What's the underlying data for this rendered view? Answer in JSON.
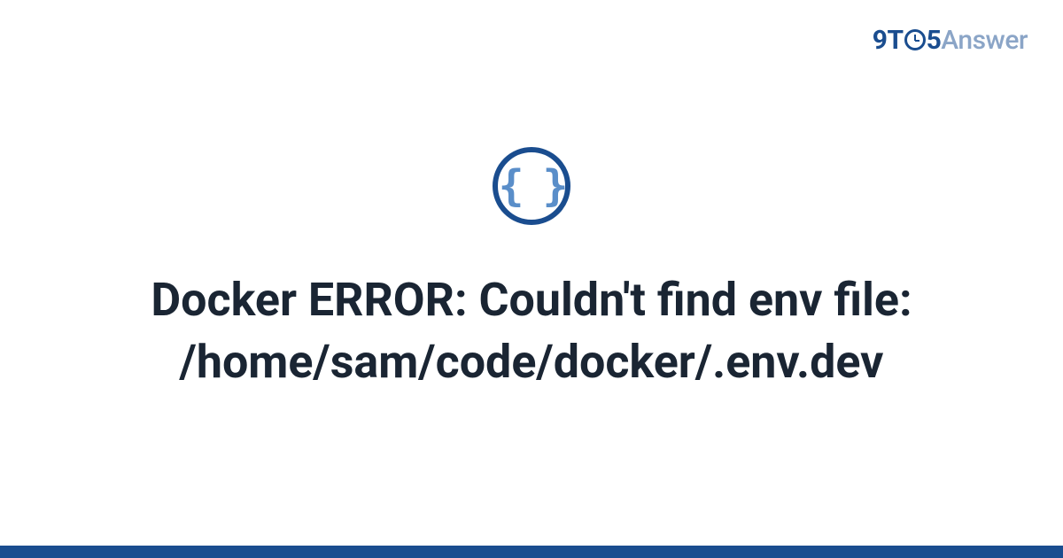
{
  "logo": {
    "part1": "9T",
    "part2": "5",
    "part3": "Answer"
  },
  "icon": {
    "braces": "{ }"
  },
  "title": "Docker ERROR: Couldn't find env file: /home/sam/code/docker/.env.dev"
}
